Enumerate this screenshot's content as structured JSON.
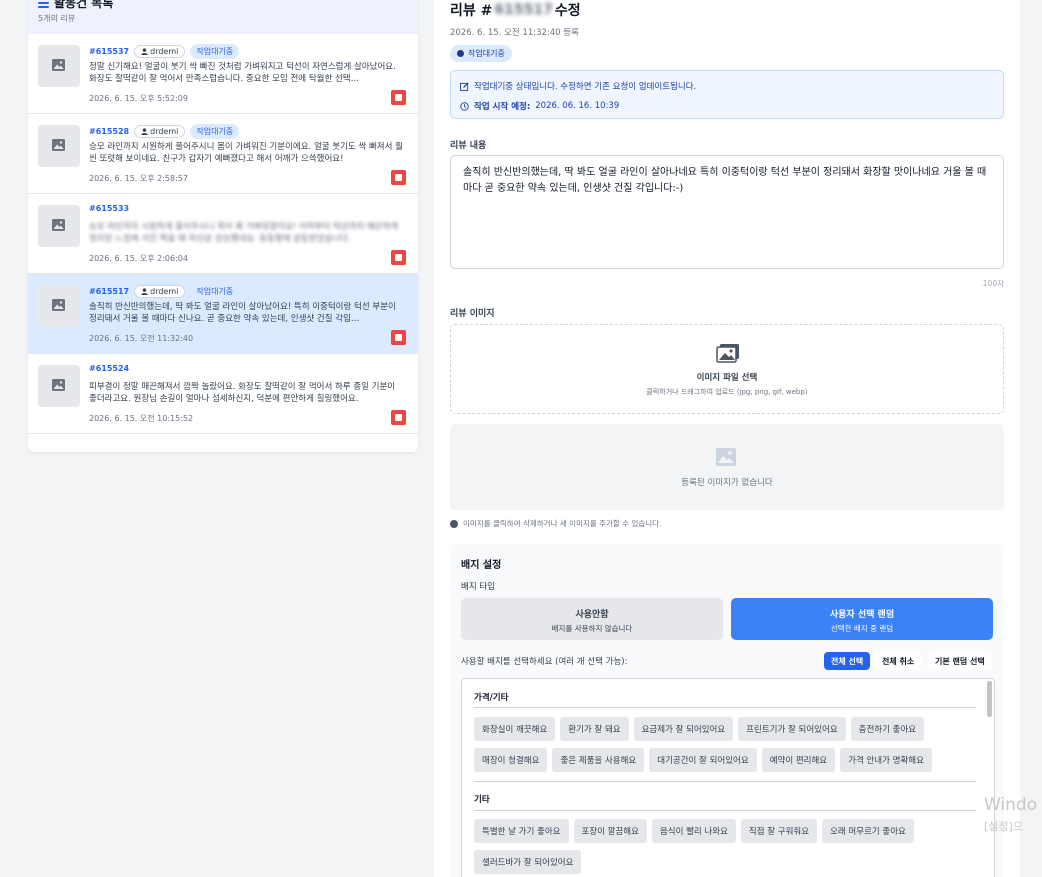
{
  "left_panel": {
    "title": "활동건 목록",
    "subtitle": "5개의 리뷰",
    "items": [
      {
        "id": "#615537",
        "user": "drdemi",
        "tag": "작업대기중",
        "text": "정말 신기해요! 얼굴이 붓기 싹 빠진 것처럼 가벼워지고 턱선이 자연스럽게 살아났어요. 화장도 찰떡같이 잘 먹어서 만족스럽습니다. 중요한 모임 전에 탁월한 선택…",
        "date": "2026. 6. 15. 오후 5:52:09",
        "blurred": false,
        "selected": false
      },
      {
        "id": "#615528",
        "user": "drdemi",
        "tag": "작업대기중",
        "text": "승모 라인까지 시원하게 풀어주시니 몸이 가벼워진 기분이에요. 얼굴 붓기도 싹 빠져서 훨씬 또렷해 보이네요. 친구가 갑자기 예뻐졌다고 해서 어깨가 으쓱했어요!",
        "date": "2026. 6. 15. 오후 2:58:57",
        "blurred": false,
        "selected": false
      },
      {
        "id": "#615533",
        "user": "",
        "tag": "",
        "text": "승모 라인까지 시원하게 풀어주시니 목이 확 가벼워졌어요! 이마부터 턱선까지 매끈하게 정리된 느낌에 사진 찍을 때 자신감 상승했네요. 동동함에 감동받았습니다.",
        "date": "2026. 6. 15. 오후 2:06:04",
        "blurred": true,
        "selected": false
      },
      {
        "id": "#615517",
        "user": "drdemi",
        "tag": "작업대기중",
        "text": "솔직히 반신반의했는데, 딱 봐도 얼굴 라인이 살아났어요! 특히 이중턱이랑 턱선 부분이 정리돼서 거울 볼 때마다 신나요. 곧 중요한 약속 있는데, 인생샷 건질 각입…",
        "date": "2026. 6. 15. 오전 11:32:40",
        "blurred": false,
        "selected": true
      },
      {
        "id": "#615524",
        "user": "",
        "tag": "",
        "text": "피부결이 정말 매끈해져서 깜짝 놀랐어요. 화장도 찰떡같이 잘 먹어서 하루 종일 기분이 좋더라고요. 원장님 손길이 얼마나 섬세하신지, 덕분에 편안하게 힐링했어요.",
        "date": "2026. 6. 15. 오전 10:15:52",
        "blurred": false,
        "selected": false
      }
    ]
  },
  "editor": {
    "title_prefix": "리뷰 #",
    "title_id": "615517",
    "title_suffix": "수정",
    "created": "2026. 6. 15. 오전 11:32:40 등록",
    "status": "작업대기중",
    "info_line1": "작업대기중 상태입니다. 수정하면 기존 요청이 업데이트됩니다.",
    "info_line2_label": "작업 시작 예정:",
    "info_line2_value": "2026. 06. 16. 10:39",
    "content_label": "리뷰 내용",
    "content": "솔직히 반신반의했는데, 딱 봐도 얼굴 라인이 살아나네요 특히 이중턱이랑 턱선 부분이 정리돼서 화장할 맛이나네요 거울 볼 때마다  곧 중요한 약속 있는데, 인생샷 건질 각입니다:-)",
    "char_count": "100자",
    "image_label": "리뷰 이미지",
    "upload_title": "이미지 파일 선택",
    "upload_sub": "클릭하거나 드래그하여 업로드 (jpg, png, gif, webp)",
    "no_image": "등록된 이미지가 없습니다",
    "image_hint": "이미지를 클릭하여 삭제하거나 새 이미지를 추가할 수 있습니다."
  },
  "badge": {
    "title": "배지 설정",
    "type_label": "배지 타입",
    "opt_off_title": "사용안함",
    "opt_off_sub": "배지를 사용하지 않습니다",
    "opt_on_title": "사용자 선택 랜덤",
    "opt_on_sub": "선택한 배지 중 랜덤",
    "select_hint": "사용할 배지를 선택하세요 (여러 개 선택 가능):",
    "btn_all": "전체 선택",
    "btn_cancel": "전체 취소",
    "btn_default": "기본 랜덤 선택",
    "groups": [
      {
        "name": "가격/기타",
        "chips": [
          "화장실이 깨끗해요",
          "환기가 잘 돼요",
          "요금제가 잘 되어있어요",
          "프린트기가 잘 되어있어요",
          "충전하기 좋아요",
          "매장이 청결해요",
          "좋은 제품을 사용해요",
          "대기공간이 잘 되어있어요",
          "예약이 편리해요",
          "가격 안내가 명확해요"
        ]
      },
      {
        "name": "기타",
        "chips": [
          "특별한 날 가기 좋아요",
          "포장이 깔끔해요",
          "음식이 빨리 나와요",
          "직접 잘 구워줘요",
          "오래 머무르기 좋아요",
          "샐러드바가 잘 되어있어요"
        ]
      }
    ]
  },
  "os_watermark": {
    "line1": "Windo",
    "line2": "[설정]으"
  }
}
